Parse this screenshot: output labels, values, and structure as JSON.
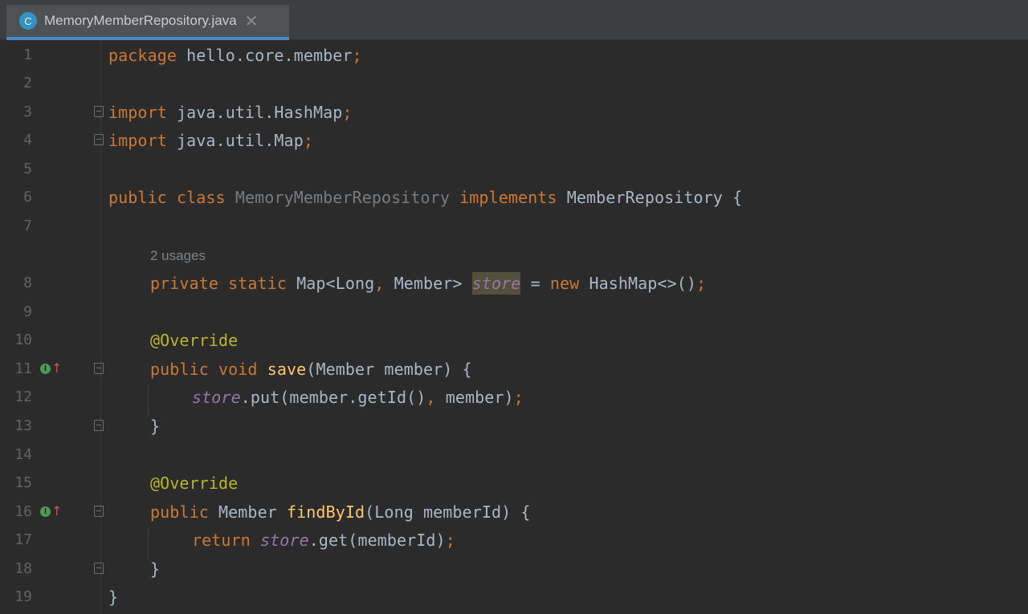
{
  "tab": {
    "title": "MemoryMemberRepository.java",
    "icon_letter": "C",
    "close_glyph": "✕"
  },
  "hint": "2 usages",
  "line_numbers": [
    "1",
    "2",
    "3",
    "4",
    "5",
    "6",
    "7",
    "8",
    "9",
    "10",
    "11",
    "12",
    "13",
    "14",
    "15",
    "16",
    "17",
    "18",
    "19"
  ],
  "code": {
    "l1": [
      "package",
      " hello.core.member",
      ";"
    ],
    "l3": [
      "import",
      " java.util.HashMap",
      ";"
    ],
    "l4": [
      "import",
      " java.util.Map",
      ";"
    ],
    "l6": [
      "public class",
      " ",
      "MemoryMemberRepository",
      " ",
      "implements",
      " MemberRepository {"
    ],
    "l8": [
      "private static",
      " Map<Long",
      ",",
      " Member> ",
      "store",
      " = ",
      "new",
      " HashMap<>()",
      ";"
    ],
    "l10": [
      "@Override"
    ],
    "l11": [
      "public void",
      " ",
      "save",
      "(Member member) {"
    ],
    "l12": [
      "store",
      ".put(member.getId()",
      ",",
      " member)",
      ";"
    ],
    "l13": [
      "}"
    ],
    "l15": [
      "@Override"
    ],
    "l16": [
      "public",
      " Member ",
      "findById",
      "(Long memberId) {"
    ],
    "l17": [
      "return",
      " ",
      "store",
      ".get(memberId)",
      ";"
    ],
    "l18": [
      "}"
    ],
    "l19": [
      "}"
    ]
  },
  "colors": {
    "keyword": "#cc7832",
    "annotation": "#bbb529",
    "method": "#ffc66d",
    "static_field": "#9876aa",
    "text": "#a9b7c6",
    "background": "#2b2b2b"
  },
  "icons": {
    "implements": "implementing-method-icon",
    "fold": "fold-marker-icon"
  }
}
